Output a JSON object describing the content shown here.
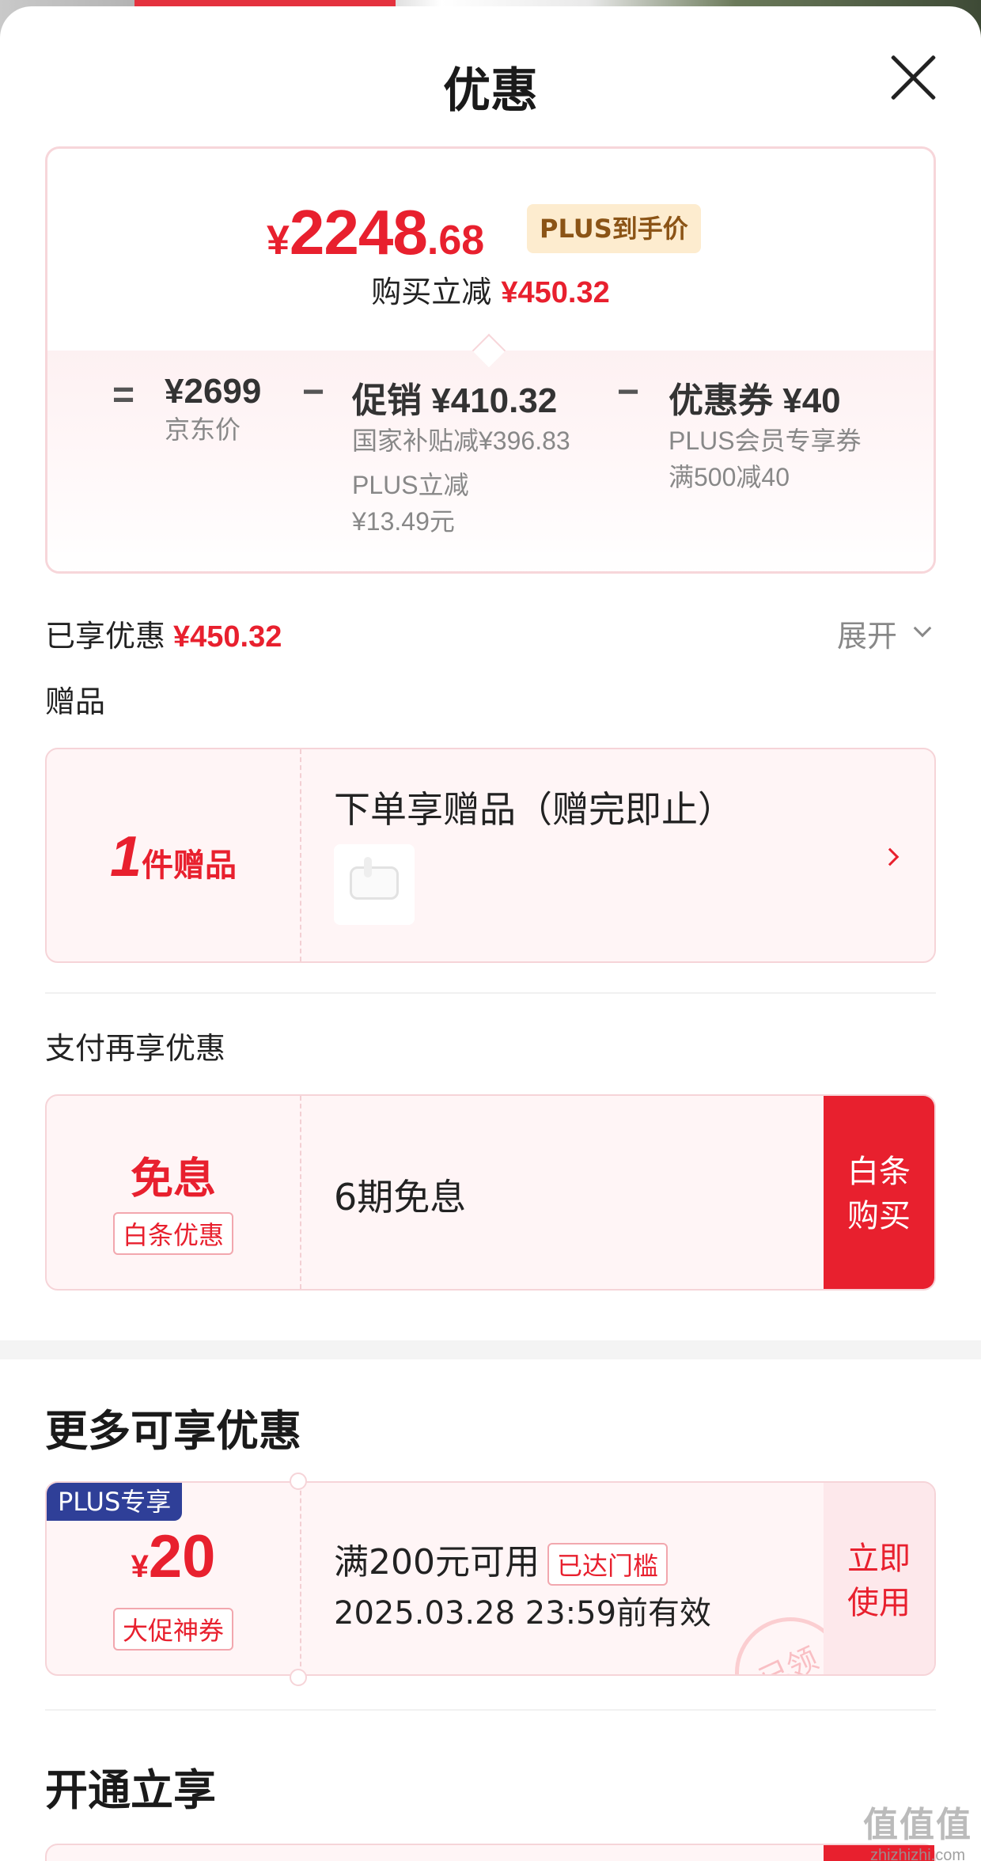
{
  "header": {
    "title": "优惠"
  },
  "price_card": {
    "currency": "¥",
    "final_int": "2248",
    "final_dec": ".68",
    "badge": "PLUS到手价",
    "instant_cut_label": "购买立减",
    "instant_cut_value": "¥450.32",
    "equals": "=",
    "minus": "−",
    "jd_price": "¥2699",
    "jd_price_label": "京东价",
    "promo": "促销 ¥410.32",
    "promo_sub1": "国家补贴减¥396.83",
    "promo_sub2a": "PLUS立减",
    "promo_sub2b": "¥13.49元",
    "coupon": "优惠券 ¥40",
    "coupon_sub1": "PLUS会员专享券",
    "coupon_sub2": "满500减40"
  },
  "enjoyed": {
    "label": "已享优惠",
    "value": "¥450.32",
    "expand": "展开"
  },
  "gift": {
    "section": "赠品",
    "count": "1",
    "count_unit": "件赠品",
    "title": "下单享赠品（赠完即止）",
    "thumb_icon": "earbuds-case-image"
  },
  "payment": {
    "section": "支付再享优惠",
    "big": "免息",
    "tag": "白条优惠",
    "desc": "6期免息",
    "btn_line1": "白条",
    "btn_line2": "购买"
  },
  "more": {
    "heading": "更多可享优惠",
    "ribbon": "PLUS专享",
    "currency": "¥",
    "amount": "20",
    "type": "大促神券",
    "condition": "满200元可用",
    "reached": "已达门槛",
    "validity": "2025.03.28 23:59前有效",
    "btn_line1": "立即",
    "btn_line2": "使用",
    "stamp": "已领"
  },
  "open": {
    "heading": "开通立享"
  },
  "watermark": {
    "logo": "值值值",
    "url": "zhizhizhi.com"
  },
  "colors": {
    "accent": "#e8202e",
    "plus_badge_bg": "#fdeccf",
    "plus_ribbon": "#2f3f98"
  }
}
